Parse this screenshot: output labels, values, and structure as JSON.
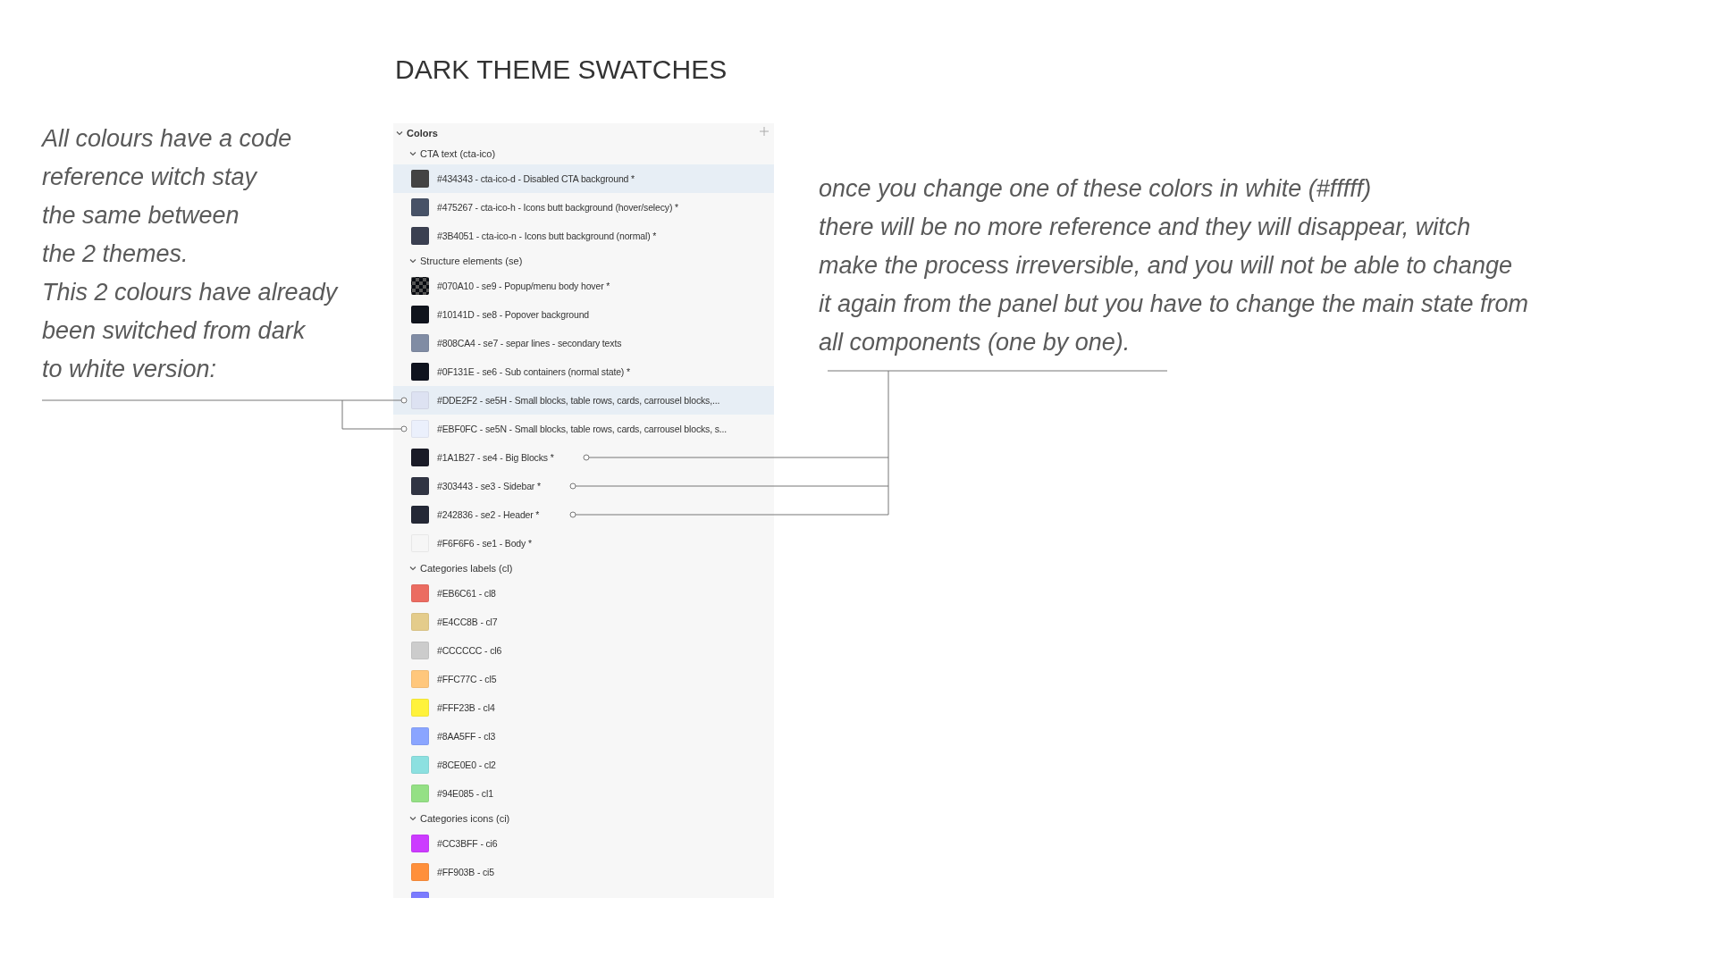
{
  "title": "DARK THEME SWATCHES",
  "left_note": {
    "lines": [
      "All colours have a code",
      "reference witch stay",
      "the same between",
      "the 2 themes.",
      "This 2 colours have already",
      "been switched from dark",
      "to white version:"
    ]
  },
  "panel": {
    "header": "Colors",
    "expanded": true,
    "groups": [
      {
        "label": "CTA text (cta-ico)",
        "expanded": true,
        "swatches": [
          {
            "kind": "solid",
            "color": "#434343",
            "label": "#434343 - cta-ico-d - Disabled CTA background *",
            "highlighted": true
          },
          {
            "kind": "solid",
            "color": "#475267",
            "label": "#475267 - cta-ico-h - Icons butt background (hover/selecy) *",
            "highlighted": false
          },
          {
            "kind": "solid",
            "color": "#3b4051",
            "label": "#3B4051 - cta-ico-n - Icons butt background (normal) *",
            "highlighted": false
          }
        ]
      },
      {
        "label": "Structure elements (se)",
        "expanded": true,
        "swatches": [
          {
            "kind": "checker",
            "color": "#070a10",
            "label": "#070A10 - se9 - Popup/menu body hover *",
            "highlighted": false
          },
          {
            "kind": "solid",
            "color": "#10141d",
            "label": "#10141D - se8 - Popover background",
            "highlighted": false
          },
          {
            "kind": "solid",
            "color": "#808ca4",
            "label": "#808CA4 - se7 - separ lines - secondary texts",
            "highlighted": false
          },
          {
            "kind": "solid",
            "color": "#0f131e",
            "label": "#0F131E - se6 - Sub containers (normal state) *",
            "highlighted": false
          },
          {
            "kind": "solid",
            "color": "#dde2f2",
            "label": "#DDE2F2 - se5H - Small blocks, table rows, cards, carrousel blocks,...",
            "highlighted": true
          },
          {
            "kind": "solid",
            "color": "#ebf0fc",
            "label": "#EBF0FC - se5N - Small blocks, table rows, cards, carrousel blocks, s...",
            "highlighted": false
          },
          {
            "kind": "solid",
            "color": "#1a1b27",
            "label": "#1A1B27 - se4 - Big Blocks *",
            "highlighted": false
          },
          {
            "kind": "solid",
            "color": "#303443",
            "label": "#303443 - se3 - Sidebar *",
            "highlighted": false
          },
          {
            "kind": "solid",
            "color": "#242836",
            "label": "#242836 - se2 - Header *",
            "highlighted": false
          },
          {
            "kind": "solid",
            "color": "#f6f6f6",
            "label": "#F6F6F6 - se1 - Body *",
            "highlighted": false
          }
        ]
      },
      {
        "label": "Categories labels (cl)",
        "expanded": true,
        "swatches": [
          {
            "kind": "solid",
            "color": "#eb6c61",
            "label": "#EB6C61 - cl8",
            "highlighted": false
          },
          {
            "kind": "solid",
            "color": "#e4cc8b",
            "label": "#E4CC8B - cl7",
            "highlighted": false
          },
          {
            "kind": "solid",
            "color": "#cccccc",
            "label": "#CCCCCC - cl6",
            "highlighted": false
          },
          {
            "kind": "solid",
            "color": "#ffc77c",
            "label": "#FFC77C - cl5",
            "highlighted": false
          },
          {
            "kind": "solid",
            "color": "#fff23b",
            "label": "#FFF23B - cl4",
            "highlighted": false
          },
          {
            "kind": "solid",
            "color": "#8aa5ff",
            "label": "#8AA5FF - cl3",
            "highlighted": false
          },
          {
            "kind": "solid",
            "color": "#8ce0e0",
            "label": "#8CE0E0 - cl2",
            "highlighted": false
          },
          {
            "kind": "solid",
            "color": "#94e085",
            "label": "#94E085 - cl1",
            "highlighted": false
          }
        ]
      },
      {
        "label": "Categories icons (ci)",
        "expanded": true,
        "swatches": [
          {
            "kind": "solid",
            "color": "#cc3bff",
            "label": "#CC3BFF - ci6",
            "highlighted": false
          },
          {
            "kind": "solid",
            "color": "#ff903b",
            "label": "#FF903B - ci5",
            "highlighted": false
          },
          {
            "kind": "solid",
            "color": "#7b7bff",
            "highlighted": false
          }
        ]
      }
    ]
  },
  "right_note": {
    "lines": [
      "once you change one of these colors in white (#fffff)",
      "there will be no more reference and they will disappear, witch",
      "make the process irreversible, and you will not be able to change",
      "it again from the panel but you have to change the main state from",
      "all components (one by one)."
    ]
  }
}
